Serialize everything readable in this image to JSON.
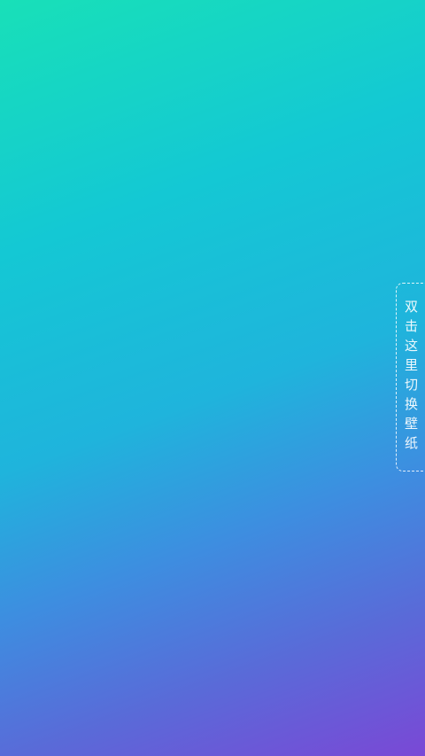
{
  "wallpaper": {
    "gradient_colors": [
      "#18e0b8",
      "#14c8d4",
      "#1fb4dc",
      "#3d8ee0",
      "#5a6ad8",
      "#7a48d6"
    ]
  },
  "switch_hint": {
    "label": "双击这里切换壁纸"
  }
}
